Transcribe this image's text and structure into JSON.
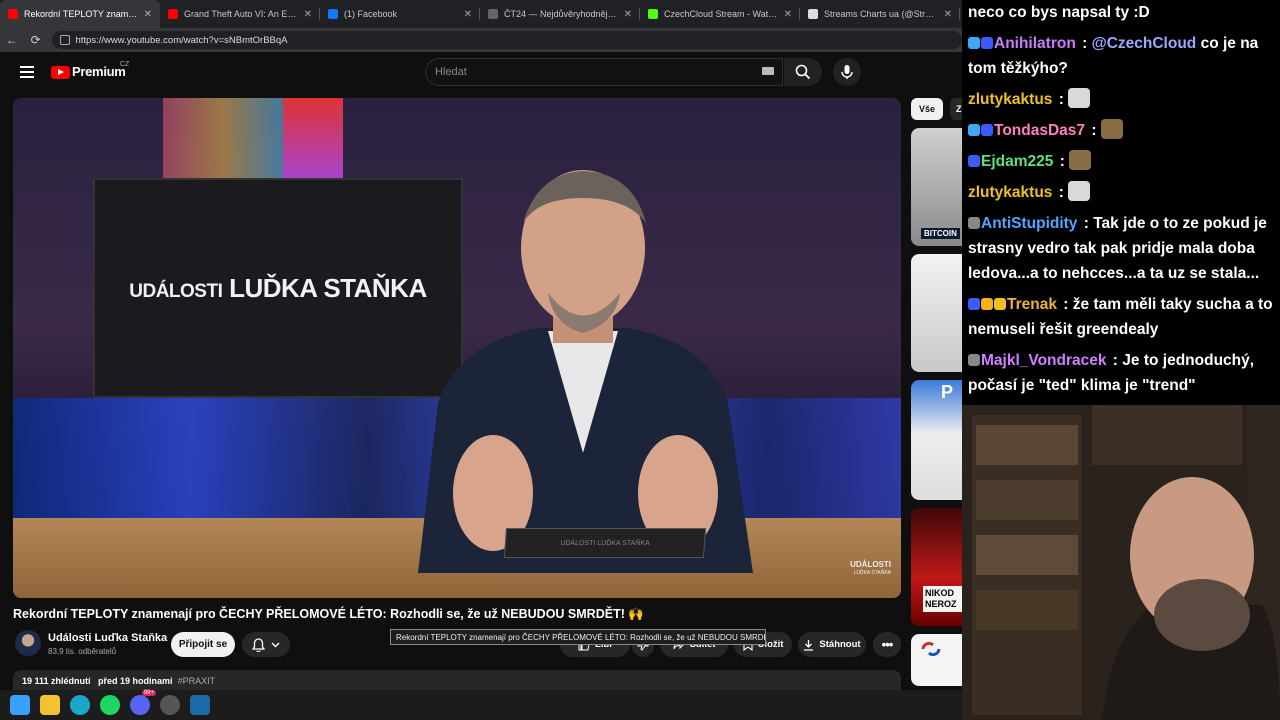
{
  "browser": {
    "tabs": [
      {
        "title": "Rekordní TEPLOTY znamenají pro Č",
        "active": true,
        "favicon_color": "#ff0000"
      },
      {
        "title": "Grand Theft Auto VI: An Extended",
        "active": false,
        "favicon_color": "#ff0000"
      },
      {
        "title": "(1) Facebook",
        "active": false,
        "favicon_color": "#1877f2"
      },
      {
        "title": "ČT24 — Nejdůvěryhodnější zprav",
        "active": false,
        "favicon_color": "#666666"
      },
      {
        "title": "CzechCloud Stream - Watch Live o",
        "active": false,
        "favicon_color": "#53fc18"
      },
      {
        "title": "Streams Charts ua (@StreamsChar",
        "active": false,
        "favicon_color": "#dddddd"
      }
    ],
    "url": "https://www.youtube.com/watch?v=sNBmtOrBBqA"
  },
  "youtube": {
    "logo_text": "Premium",
    "region": "CZ",
    "search_placeholder": "Hledat",
    "video": {
      "overlay_title_small": "UDÁLOSTI",
      "overlay_title_big": "LUĎKA STAŇKA",
      "tablet_text": "UDÁLOSTI LUĎKA STAŇKA",
      "watermark_line1": "UDÁLOSTI",
      "watermark_line2": "LUĎKA STAŇKA"
    },
    "title": "Rekordní TEPLOTY znamenají pro ČECHY PŘELOMOVÉ LÉTO: Rozhodli se, že už NEBUDOU SMRDĚT! 🙌",
    "tooltip": "Rekordní TEPLOTY znamenají  pro ČECHY PŘELOMOVÉ LÉTO: Rozhodli se, že už NEBUDOU SMRDĚT! 🙌",
    "channel": {
      "name": "Události Luďka Staňka",
      "subscribers": "83,9 tis. odběratelů"
    },
    "join_label": "Připojit se",
    "actions": {
      "like": "Líbí",
      "share": "Sdílet",
      "save": "Uložit",
      "download": "Stáhnout"
    },
    "description": {
      "views": "19 111 zhlédnutí",
      "time": "před 19 hodinami",
      "hashtag": "#PRAXIT"
    },
    "chips": [
      "Vše",
      "Z"
    ],
    "thumbs": [
      {
        "label": "BITCOIN"
      },
      {
        "label": ""
      },
      {
        "label": "P"
      },
      {
        "label": "NIKOD NEROZ"
      },
      {
        "label": ""
      }
    ]
  },
  "chat": {
    "messages": [
      {
        "user": "",
        "color": "#ffffff",
        "text": "neco co bys napsal ty :D",
        "badges": [],
        "emote": false
      },
      {
        "user": "Anihilatron",
        "color": "#c77dff",
        "text": "@CzechCloud co je na tom těžkýho?",
        "badges": [
          "#3fa9f5",
          "#3a5bff"
        ],
        "emote": false,
        "mention": "@CzechCloud"
      },
      {
        "user": "zlutykaktus",
        "color": "#f0c020",
        "text": "",
        "badges": [],
        "emote": true,
        "emote_color": "#ffffff"
      },
      {
        "user": "TondasDas7",
        "color": "#ff7fbf",
        "text": "",
        "badges": [
          "#3fa9f5",
          "#3a5bff"
        ],
        "emote": true,
        "emote_color": "#a08050"
      },
      {
        "user": "Ejdam225",
        "color": "#5fe07a",
        "text": "",
        "badges": [
          "#3a5bff"
        ],
        "emote": true,
        "emote_color": "#a08050"
      },
      {
        "user": "zlutykaktus",
        "color": "#f0c020",
        "text": "",
        "badges": [],
        "emote": true,
        "emote_color": "#ffffff"
      },
      {
        "user": "AntiStupidity",
        "color": "#4da6ff",
        "text": "Tak jde o to ze pokud je strasny vedro tak pak pridje mala doba ledova...a to nehcces...a ta uz se stala...",
        "badges": [
          "#888888"
        ],
        "emote": false
      },
      {
        "user": "Trenak",
        "color": "#f0b040",
        "text": "že tam měli taky sucha a to nemuseli řešit greendealy",
        "badges": [
          "#3a5bff",
          "#f0b020",
          "#f0c020"
        ],
        "emote": false
      },
      {
        "user": "Majkl_Vondracek",
        "color": "#d080ff",
        "text": "Je to jednoduchý, počasí je \"ted\" klima je \"trend\"",
        "badges": [
          "#888888"
        ],
        "emote": false
      }
    ]
  },
  "taskbar": {
    "icons": [
      "windows-icon",
      "explorer-icon",
      "edge-icon",
      "spotify-icon",
      "discord-icon",
      "obs-icon",
      "steam-icon"
    ],
    "discord_badge": "99+"
  }
}
